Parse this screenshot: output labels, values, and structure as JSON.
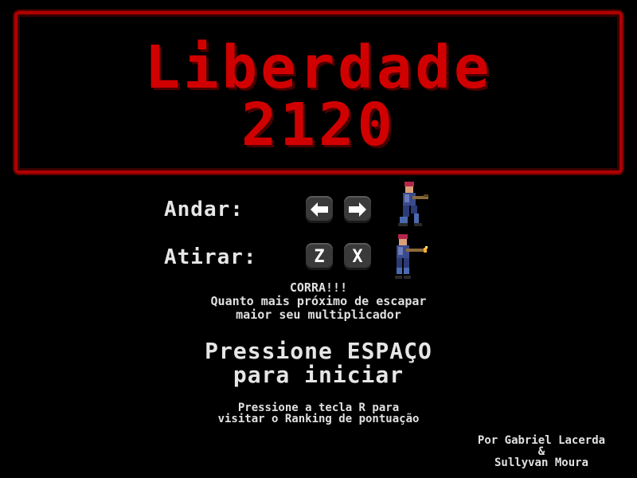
{
  "title": {
    "line1": "Liberdade",
    "line2": "2120"
  },
  "controls": {
    "walk_label": "Andar:",
    "walk_keys": [
      "left-arrow-icon",
      "right-arrow-icon"
    ],
    "shoot_label": "Atirar:",
    "shoot_keys": [
      "Z",
      "X"
    ]
  },
  "hint": {
    "line1": "CORRA!!!",
    "line2": "Quanto mais próximo de escapar",
    "line3": "maior seu multiplicador"
  },
  "start": {
    "line1": "Pressione ESPAÇO",
    "line2": "para iniciar"
  },
  "ranking": {
    "line1": "Pressione a tecla R para",
    "line2": "visitar o Ranking de pontuação"
  },
  "credits": {
    "line1": "Por Gabriel Lacerda",
    "line2": "&",
    "line3": "Sullyvan Moura"
  },
  "colors": {
    "title_red": "#d10000",
    "border_red": "#b00000",
    "background": "#000000",
    "text": "#e6e6e6"
  }
}
